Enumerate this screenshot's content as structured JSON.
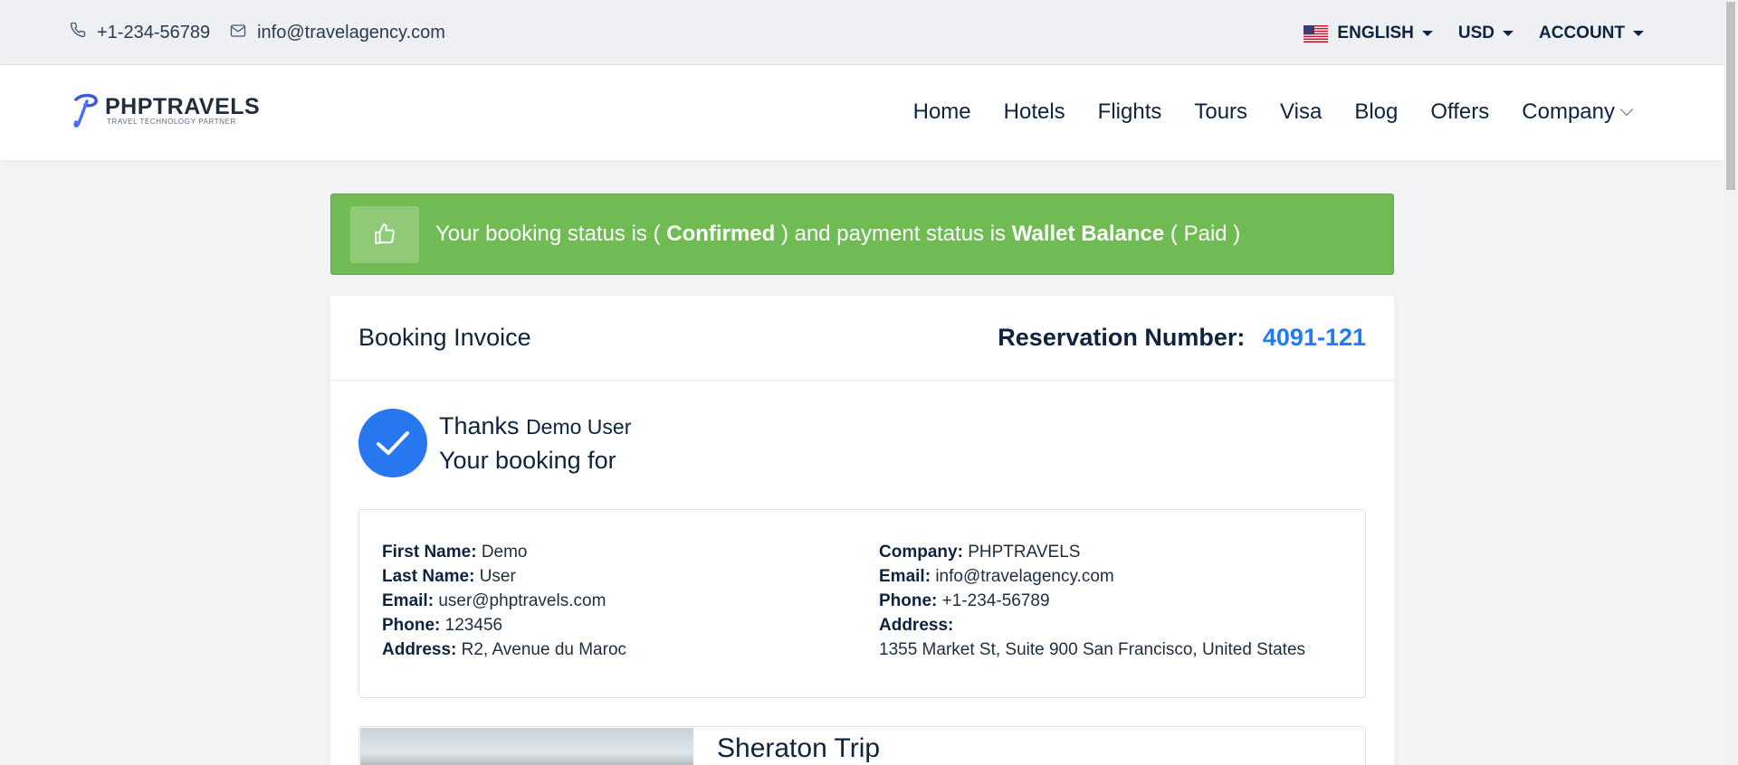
{
  "topbar": {
    "phone": "+1-234-56789",
    "email": "info@travelagency.com",
    "language": "ENGLISH",
    "currency": "USD",
    "account": "ACCOUNT"
  },
  "brand": {
    "name": "PHPTRAVELS",
    "tagline": "TRAVEL TECHNOLOGY PARTNER"
  },
  "nav": {
    "items": [
      "Home",
      "Hotels",
      "Flights",
      "Tours",
      "Visa",
      "Blog",
      "Offers",
      "Company"
    ]
  },
  "alert": {
    "prefix": "Your booking status is (",
    "status": "Confirmed",
    "middle": ") and payment status is",
    "payment": "Wallet Balance",
    "suffix": "( Paid )"
  },
  "invoice": {
    "title": "Booking Invoice",
    "reservation_label": "Reservation Number:",
    "reservation_number": "4091-121",
    "thanks": "Thanks",
    "user": "Demo User",
    "booking_for": "Your booking for"
  },
  "customer": {
    "first_name_label": "First Name:",
    "first_name": "Demo",
    "last_name_label": "Last Name:",
    "last_name": "User",
    "email_label": "Email:",
    "email": "user@phptravels.com",
    "phone_label": "Phone:",
    "phone": "123456",
    "address_label": "Address:",
    "address": "R2, Avenue du Maroc"
  },
  "company": {
    "company_label": "Company:",
    "company": "PHPTRAVELS",
    "email_label": "Email:",
    "email": "info@travelagency.com",
    "phone_label": "Phone:",
    "phone": "+1-234-56789",
    "address_label": "Address:",
    "address": "1355 Market St, Suite 900 San Francisco, United States"
  },
  "trip": {
    "title": "Sheraton Trip"
  },
  "colors": {
    "accent": "#1f7cf2",
    "success": "#70bb53",
    "check": "#2777f0"
  }
}
